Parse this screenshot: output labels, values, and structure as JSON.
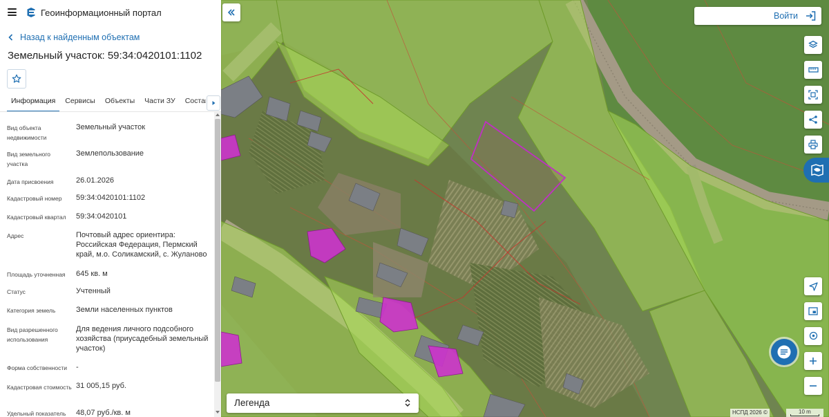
{
  "header": {
    "portal_title": "Геоинформационный портал",
    "menu_icon": "menu-icon",
    "logo_icon": "portal-logo-icon"
  },
  "navigation": {
    "back_label": "Назад к найденным объектам"
  },
  "object": {
    "title": "Земельный участок: 59:34:0420101:1102"
  },
  "tabs": [
    {
      "label": "Информация",
      "active": true
    },
    {
      "label": "Сервисы",
      "active": false
    },
    {
      "label": "Объекты",
      "active": false
    },
    {
      "label": "Части ЗУ",
      "active": false
    },
    {
      "label": "Состав",
      "active": false
    }
  ],
  "attributes": [
    {
      "label": "Вид объекта недвижимости",
      "value": "Земельный участок"
    },
    {
      "label": "Вид земельного участка",
      "value": "Землепользование"
    },
    {
      "label": "Дата присвоения",
      "value": "26.01.2026"
    },
    {
      "label": "Кадастровый номер",
      "value": "59:34:0420101:1102"
    },
    {
      "label": "Кадастровый квартал",
      "value": "59:34:0420101"
    },
    {
      "label": "Адрес",
      "value": "Почтовый адрес ориентира: Российская Федерация, Пермский край, м.о. Соликамский, с. Жуланово"
    },
    {
      "label": "Площадь уточненная",
      "value": "645 кв. м"
    },
    {
      "label": "Статус",
      "value": "Учтенный"
    },
    {
      "label": "Категория земель",
      "value": "Земли населенных пунктов"
    },
    {
      "label": "Вид разрешенного использования",
      "value": "Для ведения личного подсобного хозяйства (приусадебный земельный участок)"
    },
    {
      "label": "Форма собственности",
      "value": "-"
    },
    {
      "label": "Кадастровая стоимость",
      "value": "31 005,15 руб."
    },
    {
      "label": "Удельный показатель",
      "value": "48,07 руб./кв. м"
    }
  ],
  "map": {
    "login_label": "Войти",
    "legend_label": "Легенда",
    "copyright": "НСПД 2026 ©",
    "scale_label": "10 m",
    "tools_top": [
      "layers-icon",
      "ruler-icon",
      "select-area-icon",
      "share-icon",
      "print-icon"
    ],
    "active_tool": "map-zone-icon",
    "tools_bottom": [
      "locate-icon",
      "minimap-icon",
      "geo-pin-icon",
      "zoom-in-icon",
      "zoom-out-icon"
    ]
  },
  "colors": {
    "accent": "#1f6fb2",
    "parcel_fill": "#a9d85a",
    "parcel_border": "#6f9b2c",
    "selected_parcel": "#c02fc4",
    "building": "#cc33cc"
  }
}
